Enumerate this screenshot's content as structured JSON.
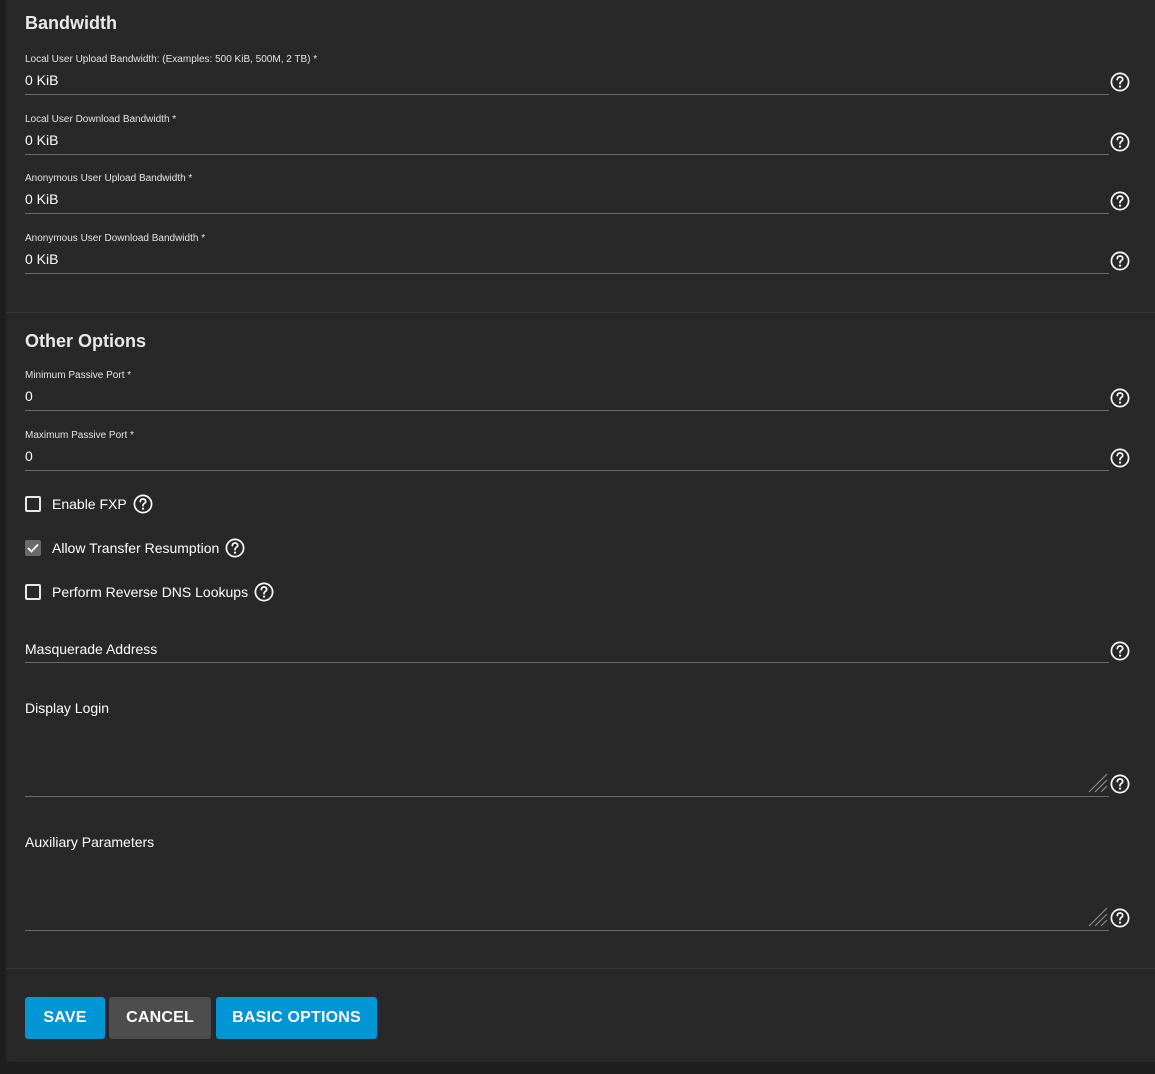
{
  "bandwidth": {
    "title": "Bandwidth",
    "fields": [
      {
        "label": "Local User Upload Bandwidth: (Examples: 500 KiB, 500M, 2 TB) *",
        "value": "0 KiB"
      },
      {
        "label": "Local User Download Bandwidth *",
        "value": "0 KiB"
      },
      {
        "label": "Anonymous User Upload Bandwidth *",
        "value": "0 KiB"
      },
      {
        "label": "Anonymous User Download Bandwidth *",
        "value": "0 KiB"
      }
    ]
  },
  "other_options": {
    "title": "Other Options",
    "min_port": {
      "label": "Minimum Passive Port *",
      "value": "0"
    },
    "max_port": {
      "label": "Maximum Passive Port *",
      "value": "0"
    },
    "checkboxes": [
      {
        "label": "Enable FXP",
        "checked": false
      },
      {
        "label": "Allow Transfer Resumption",
        "checked": true
      },
      {
        "label": "Perform Reverse DNS Lookups",
        "checked": false
      }
    ],
    "masquerade": {
      "placeholder": "Masquerade Address",
      "value": ""
    },
    "display_login": {
      "placeholder": "Display Login",
      "value": ""
    },
    "aux_params": {
      "placeholder": "Auxiliary Parameters",
      "value": ""
    }
  },
  "actions": {
    "save": "SAVE",
    "cancel": "CANCEL",
    "basic_options": "BASIC OPTIONS"
  },
  "colors": {
    "page_bg": "#1e1e1e",
    "card_bg": "#282828",
    "primary": "#0095d5",
    "secondary": "#4d4d4d"
  },
  "icons": {
    "help": "help-circle-icon",
    "check": "check-icon",
    "resize": "resize-handle-icon"
  }
}
